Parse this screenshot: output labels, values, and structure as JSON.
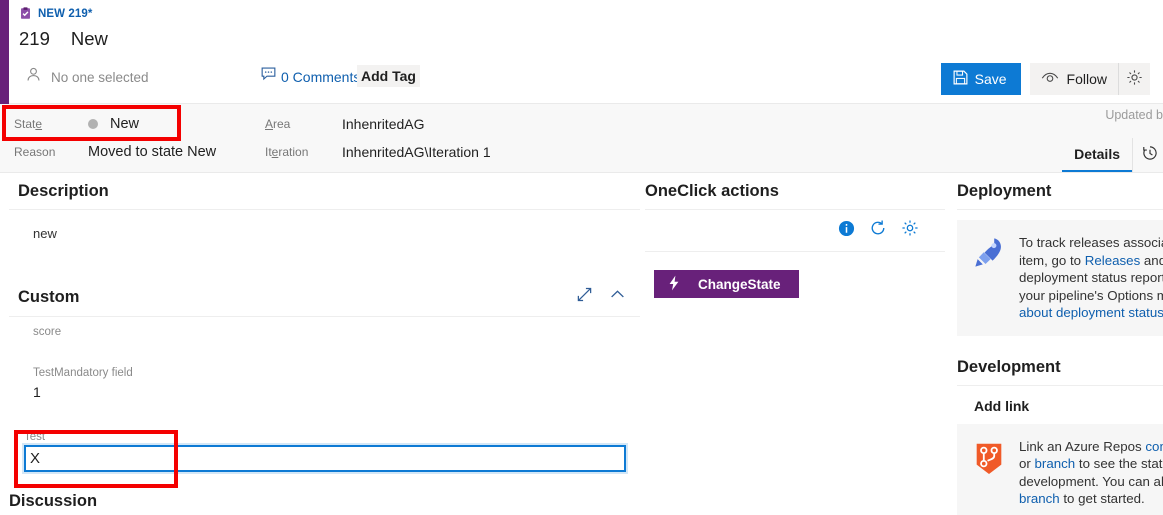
{
  "tab": {
    "label": "NEW 219*",
    "icon": "task-clipboard-icon"
  },
  "title": {
    "id": "219",
    "name": "New"
  },
  "meta": {
    "assignee": "No one selected",
    "comments": "0 Comments",
    "add_tag": "Add Tag",
    "save": "Save",
    "follow": "Follow"
  },
  "band": {
    "state_label": "State",
    "state_value": "New",
    "reason_label": "Reason",
    "reason_value": "Moved to state New",
    "area_label": "Area",
    "area_value": "InhenritedAG",
    "iteration_label": "Iteration",
    "iteration_value": "InhenritedAG\\Iteration 1",
    "updated": "Updated b",
    "tab_details": "Details"
  },
  "description": {
    "heading": "Description",
    "body": "new"
  },
  "custom": {
    "heading": "Custom",
    "fields": [
      {
        "label": "score",
        "value": ""
      },
      {
        "label": "TestMandatory field",
        "value": "1"
      }
    ],
    "test_label": "Test",
    "test_value": "X"
  },
  "discussion": {
    "heading": "Discussion"
  },
  "oneclick": {
    "heading": "OneClick actions",
    "button": "ChangeState"
  },
  "deployment": {
    "heading": "Deployment",
    "line1_a": "To track releases associated ",
    "line2_a": "item, go to ",
    "line2_link": "Releases",
    "line2_b": " and tur",
    "line3_a": "deployment status reporting",
    "line4_a": "your pipeline's Options men",
    "line5_link": "about deployment status rep"
  },
  "development": {
    "heading": "Development",
    "add_link": "Add link",
    "line1_a": "Link an Azure Repos ",
    "line1_link": "commit",
    "line2_a": "or ",
    "line2_link": "branch",
    "line2_b": " to see the status o",
    "line3_a": "development. You can also c",
    "line4_link": "branch",
    "line4_b": " to get started."
  },
  "colors": {
    "purple": "#68217a",
    "blue": "#0d7ad4",
    "link": "#0f5fae",
    "highlight_red": "#f40000",
    "orange": "#e8562a"
  }
}
